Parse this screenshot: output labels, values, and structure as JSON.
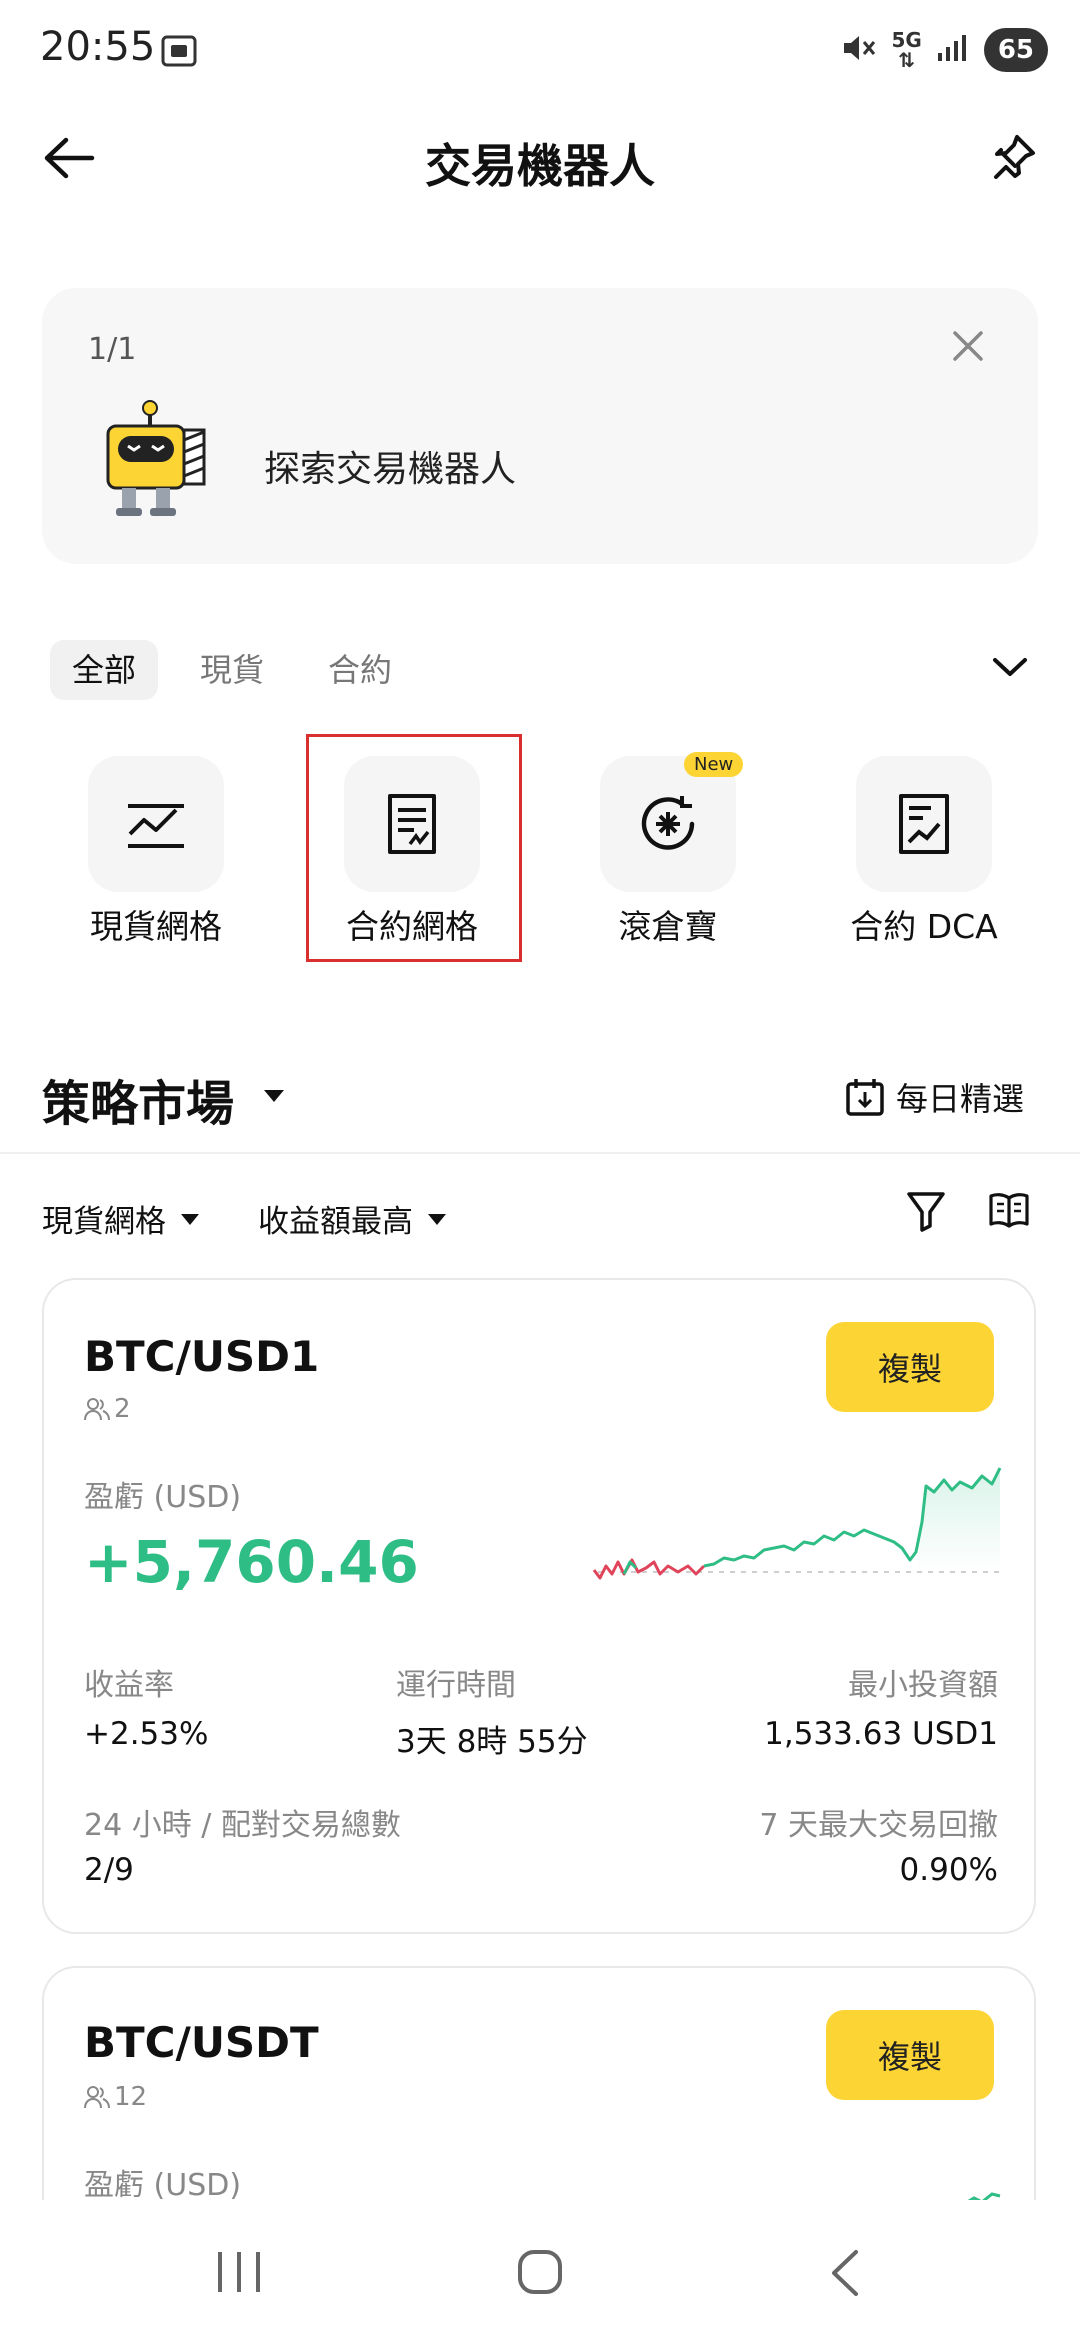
{
  "status": {
    "time": "20:55",
    "net_top": "5G",
    "battery": "65"
  },
  "header": {
    "title": "交易機器人"
  },
  "banner": {
    "count": "1/1",
    "text": "探索交易機器人"
  },
  "tabs": [
    {
      "label": "全部",
      "active": true
    },
    {
      "label": "現貨"
    },
    {
      "label": "合約"
    }
  ],
  "bots": [
    {
      "label": "現貨網格",
      "icon": "chart-line-icon"
    },
    {
      "label": "合約網格",
      "icon": "document-sign-icon"
    },
    {
      "label": "滾倉寶",
      "icon": "rollover-icon",
      "badge": "New"
    },
    {
      "label": "合約 DCA",
      "icon": "chart-doc-icon"
    }
  ],
  "market": {
    "title": "策略市場",
    "daily": "每日精選",
    "filter_type": "現貨網格",
    "filter_sort": "收益額最高"
  },
  "cards": [
    {
      "pair": "BTC/USD1",
      "followers": "2",
      "copy": "複製",
      "pnl_label": "盈虧 (USD)",
      "pnl": "+5,760.46",
      "roi_label": "收益率",
      "roi": "+2.53%",
      "runtime_label": "運行時間",
      "runtime": "3天 8時 55分",
      "min_label": "最小投資額",
      "min": "1,533.63 USD1",
      "trades_label": "24 小時 / 配對交易總數",
      "trades": "2/9",
      "drawdown_label": "7 天最大交易回撤",
      "drawdown": "0.90%"
    },
    {
      "pair": "BTC/USDT",
      "followers": "12",
      "copy": "複製",
      "pnl_label": "盈虧 (USD)"
    }
  ],
  "colors": {
    "accent": "#fcd535",
    "profit": "#2ebd85",
    "loss": "#e0445a",
    "highlight": "#d82f2f"
  }
}
